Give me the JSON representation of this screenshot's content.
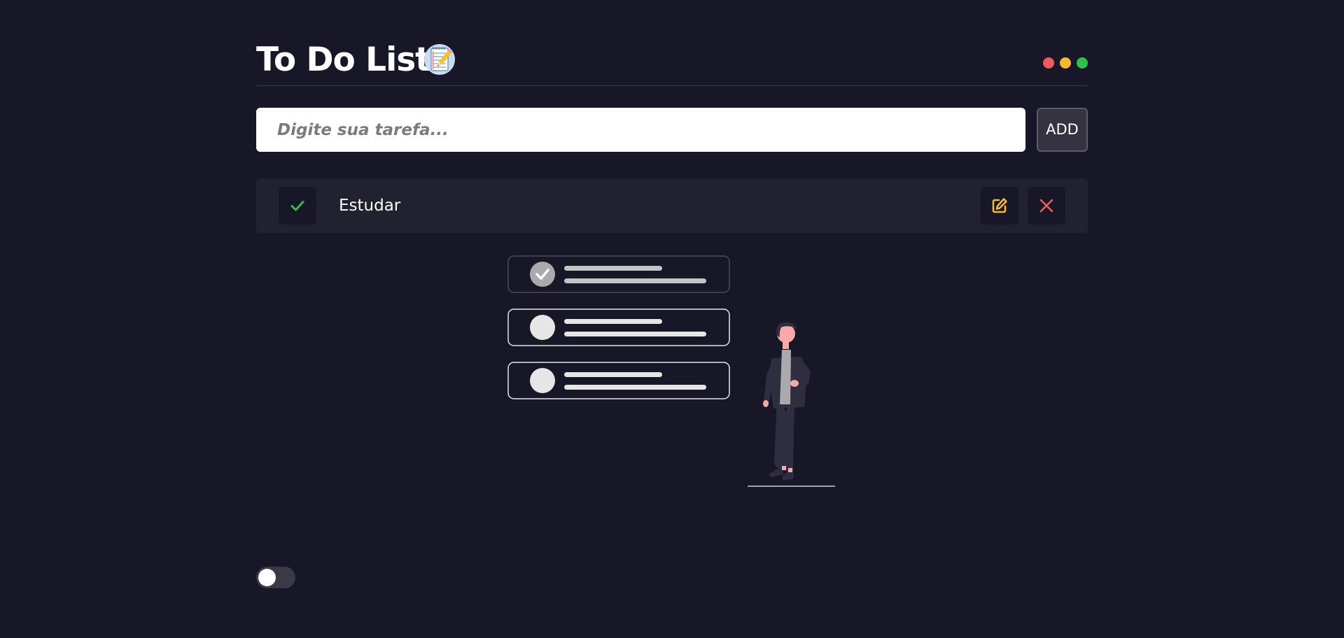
{
  "header": {
    "title": "To Do List",
    "title_icon": "notepad-pencil-icon",
    "window_dots": [
      {
        "name": "close",
        "color": "#ef5a5a"
      },
      {
        "name": "minimize",
        "color": "#f5b82e"
      },
      {
        "name": "maximize",
        "color": "#2ec149"
      }
    ]
  },
  "input": {
    "placeholder": "Digite sua tarefa...",
    "value": "",
    "add_label": "ADD"
  },
  "todos": [
    {
      "text": "Estudar",
      "check_icon": "check-icon",
      "edit_icon": "edit-icon",
      "delete_icon": "close-icon"
    }
  ],
  "colors": {
    "background": "#181727",
    "item_background": "#22212f",
    "check": "#2ec149",
    "edit": "#f5b82e",
    "delete": "#ef5a5a"
  },
  "theme_toggle": {
    "state": "off"
  }
}
